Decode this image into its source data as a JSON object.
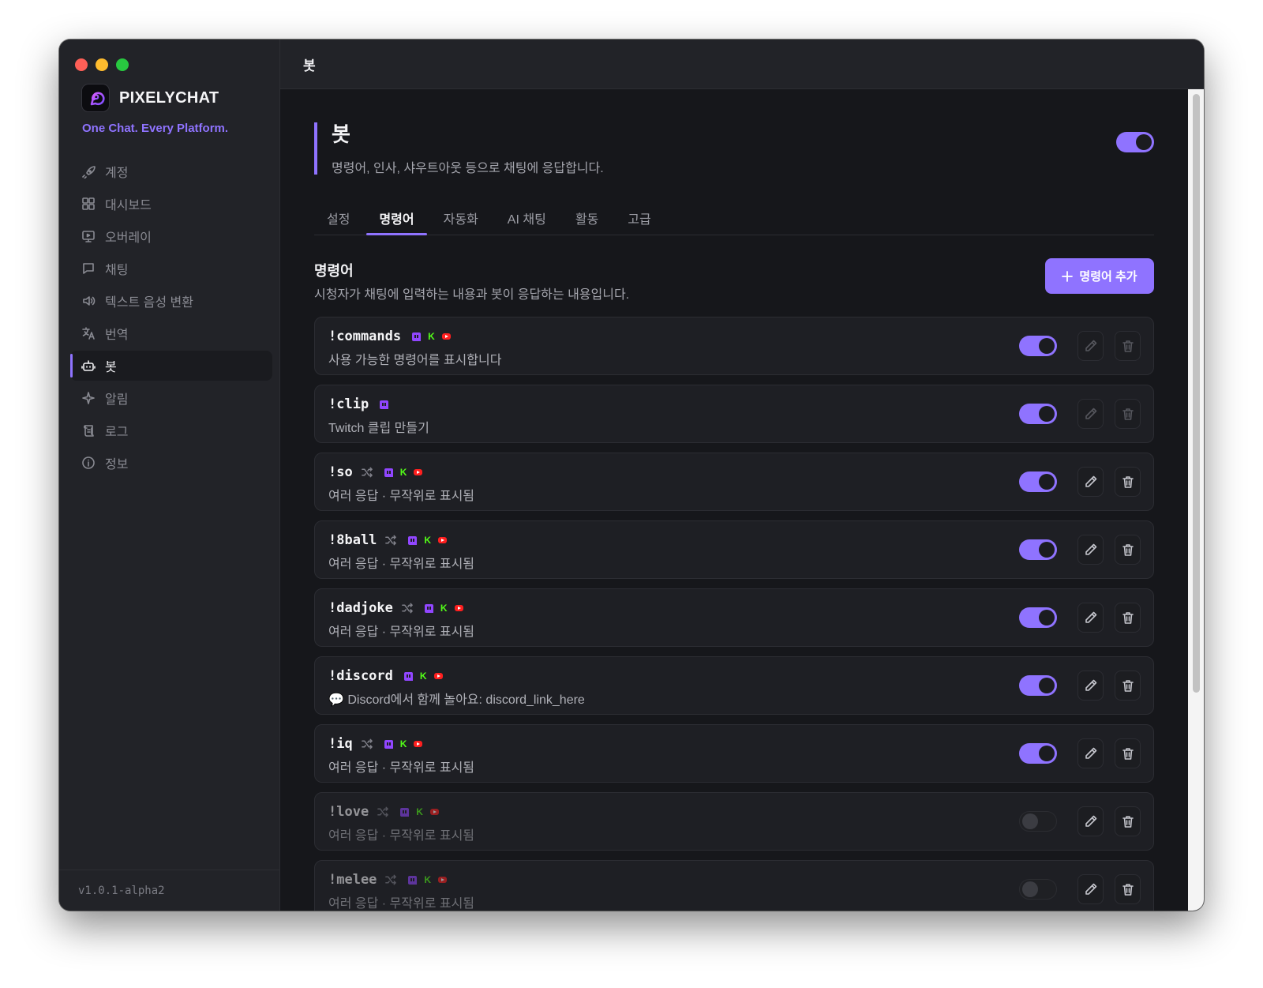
{
  "app": {
    "name": "PIXELYCHAT",
    "tagline": "One Chat. Every Platform.",
    "version": "v1.0.1-alpha2",
    "accent": "#8f73ff"
  },
  "sidebar": {
    "items": [
      {
        "label": "계정",
        "icon": "rocket-icon",
        "active": false
      },
      {
        "label": "대시보드",
        "icon": "grid-icon",
        "active": false
      },
      {
        "label": "오버레이",
        "icon": "monitor-icon",
        "active": false
      },
      {
        "label": "채팅",
        "icon": "chat-icon",
        "active": false
      },
      {
        "label": "텍스트 음성 변환",
        "icon": "speaker-icon",
        "active": false
      },
      {
        "label": "번역",
        "icon": "translate-icon",
        "active": false
      },
      {
        "label": "봇",
        "icon": "bot-icon",
        "active": true
      },
      {
        "label": "알림",
        "icon": "sparkle-icon",
        "active": false
      },
      {
        "label": "로그",
        "icon": "scroll-icon",
        "active": false
      },
      {
        "label": "정보",
        "icon": "info-icon",
        "active": false
      }
    ]
  },
  "topbar": {
    "title": "봇"
  },
  "page": {
    "title": "봇",
    "description": "명령어, 인사, 샤우트아웃 등으로 채팅에 응답합니다.",
    "enabled": true
  },
  "tabs": [
    {
      "label": "설정",
      "active": false
    },
    {
      "label": "명령어",
      "active": true
    },
    {
      "label": "자동화",
      "active": false
    },
    {
      "label": "AI 채팅",
      "active": false
    },
    {
      "label": "활동",
      "active": false
    },
    {
      "label": "고급",
      "active": false
    }
  ],
  "commands_section": {
    "title": "명령어",
    "description": "시청자가 채팅에 입력하는 내용과 봇이 응답하는 내용입니다.",
    "add_button": "명령어 추가"
  },
  "commands": [
    {
      "name": "!commands",
      "random": false,
      "platforms": [
        "twitch",
        "kick",
        "youtube"
      ],
      "description": "사용 가능한 명령어를 표시합니다",
      "enabled": true,
      "locked": true
    },
    {
      "name": "!clip",
      "random": false,
      "platforms": [
        "twitch"
      ],
      "description": "Twitch 클립 만들기",
      "enabled": true,
      "locked": true
    },
    {
      "name": "!so",
      "random": true,
      "platforms": [
        "twitch",
        "kick",
        "youtube"
      ],
      "description": "여러 응답 · 무작위로 표시됨",
      "enabled": true,
      "locked": false
    },
    {
      "name": "!8ball",
      "random": true,
      "platforms": [
        "twitch",
        "kick",
        "youtube"
      ],
      "description": "여러 응답 · 무작위로 표시됨",
      "enabled": true,
      "locked": false
    },
    {
      "name": "!dadjoke",
      "random": true,
      "platforms": [
        "twitch",
        "kick",
        "youtube"
      ],
      "description": "여러 응답 · 무작위로 표시됨",
      "enabled": true,
      "locked": false
    },
    {
      "name": "!discord",
      "random": false,
      "platforms": [
        "twitch",
        "kick",
        "youtube"
      ],
      "description": "💬 Discord에서 함께 놀아요: discord_link_here",
      "enabled": true,
      "locked": false
    },
    {
      "name": "!iq",
      "random": true,
      "platforms": [
        "twitch",
        "kick",
        "youtube"
      ],
      "description": "여러 응답 · 무작위로 표시됨",
      "enabled": true,
      "locked": false
    },
    {
      "name": "!love",
      "random": true,
      "platforms": [
        "twitch",
        "kick",
        "youtube"
      ],
      "description": "여러 응답 · 무작위로 표시됨",
      "enabled": false,
      "locked": false
    },
    {
      "name": "!melee",
      "random": true,
      "platforms": [
        "twitch",
        "kick",
        "youtube"
      ],
      "description": "여러 응답 · 무작위로 표시됨",
      "enabled": false,
      "locked": false
    }
  ]
}
